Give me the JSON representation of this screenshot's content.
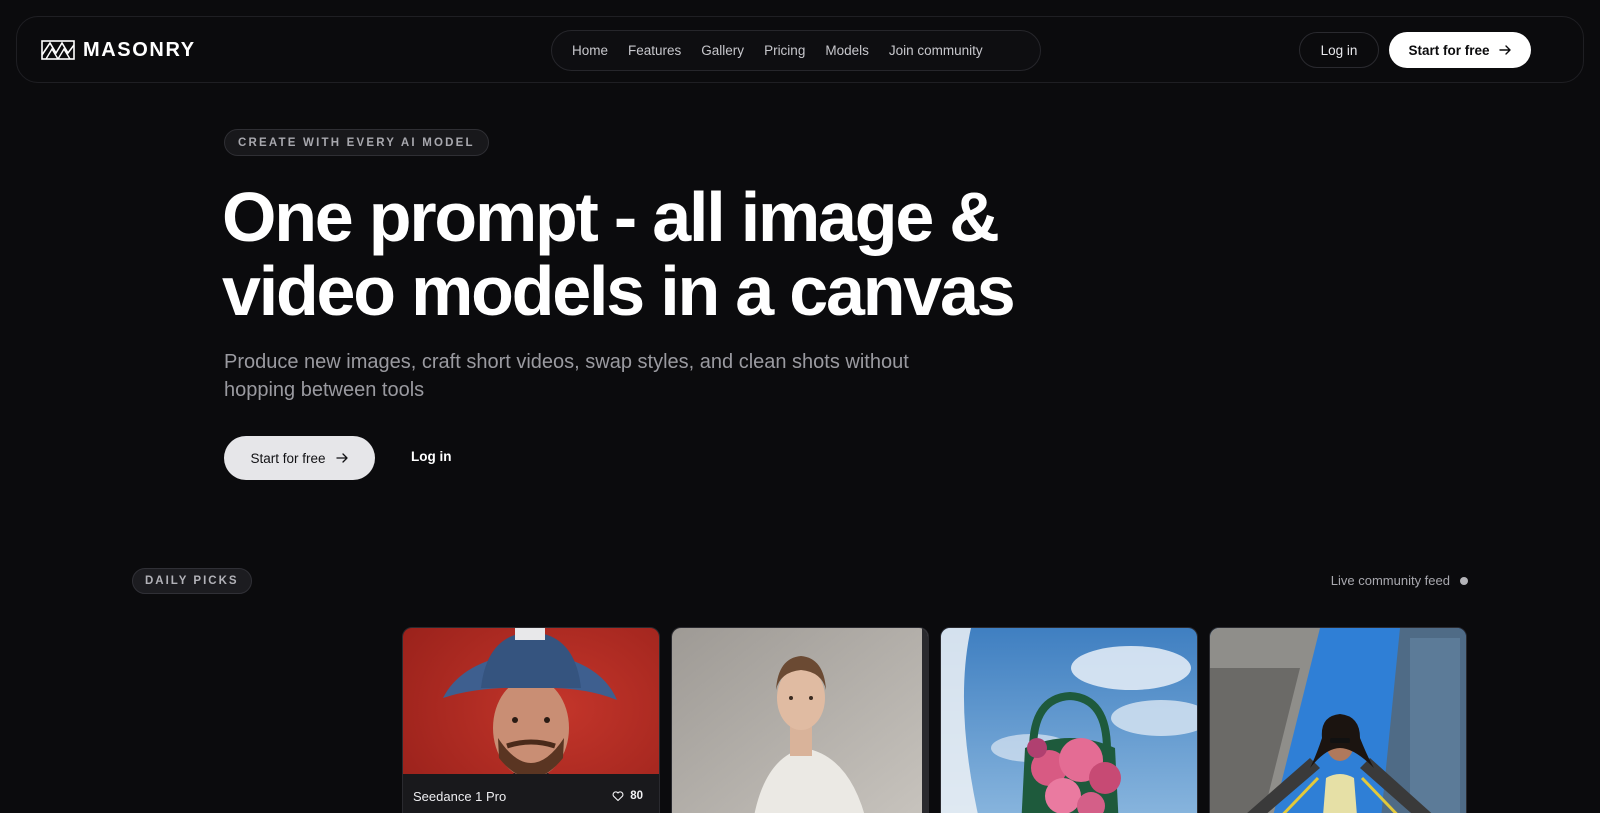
{
  "brand": {
    "name": "MASONRY"
  },
  "nav": {
    "items": [
      {
        "label": "Home"
      },
      {
        "label": "Features"
      },
      {
        "label": "Gallery"
      },
      {
        "label": "Pricing"
      },
      {
        "label": "Models"
      },
      {
        "label": "Join community"
      }
    ],
    "login_label": "Log in",
    "start_label": "Start for free"
  },
  "hero": {
    "eyebrow": "CREATE WITH EVERY AI MODEL",
    "title_line1": "One prompt - all image &",
    "title_line2": "video models in a canvas",
    "subtitle_line1": "Produce new images, craft short videos, swap styles, and clean shots without",
    "subtitle_line2": "hopping between tools",
    "start_label": "Start for free",
    "login_label": "Log in"
  },
  "picks": {
    "badge": "DAILY PICKS",
    "feed_label": "Live community feed",
    "cards": [
      {
        "model": "Seedance 1 Pro",
        "likes": "80"
      }
    ]
  },
  "colors": {
    "background": "#0b0b0d",
    "accent_button": "#ffffff",
    "muted_text": "#9a9aa0"
  },
  "icons": {
    "logo": "masonry-logo-icon",
    "arrow": "arrow-right-icon",
    "heart": "heart-icon",
    "live": "live-dot-icon"
  }
}
